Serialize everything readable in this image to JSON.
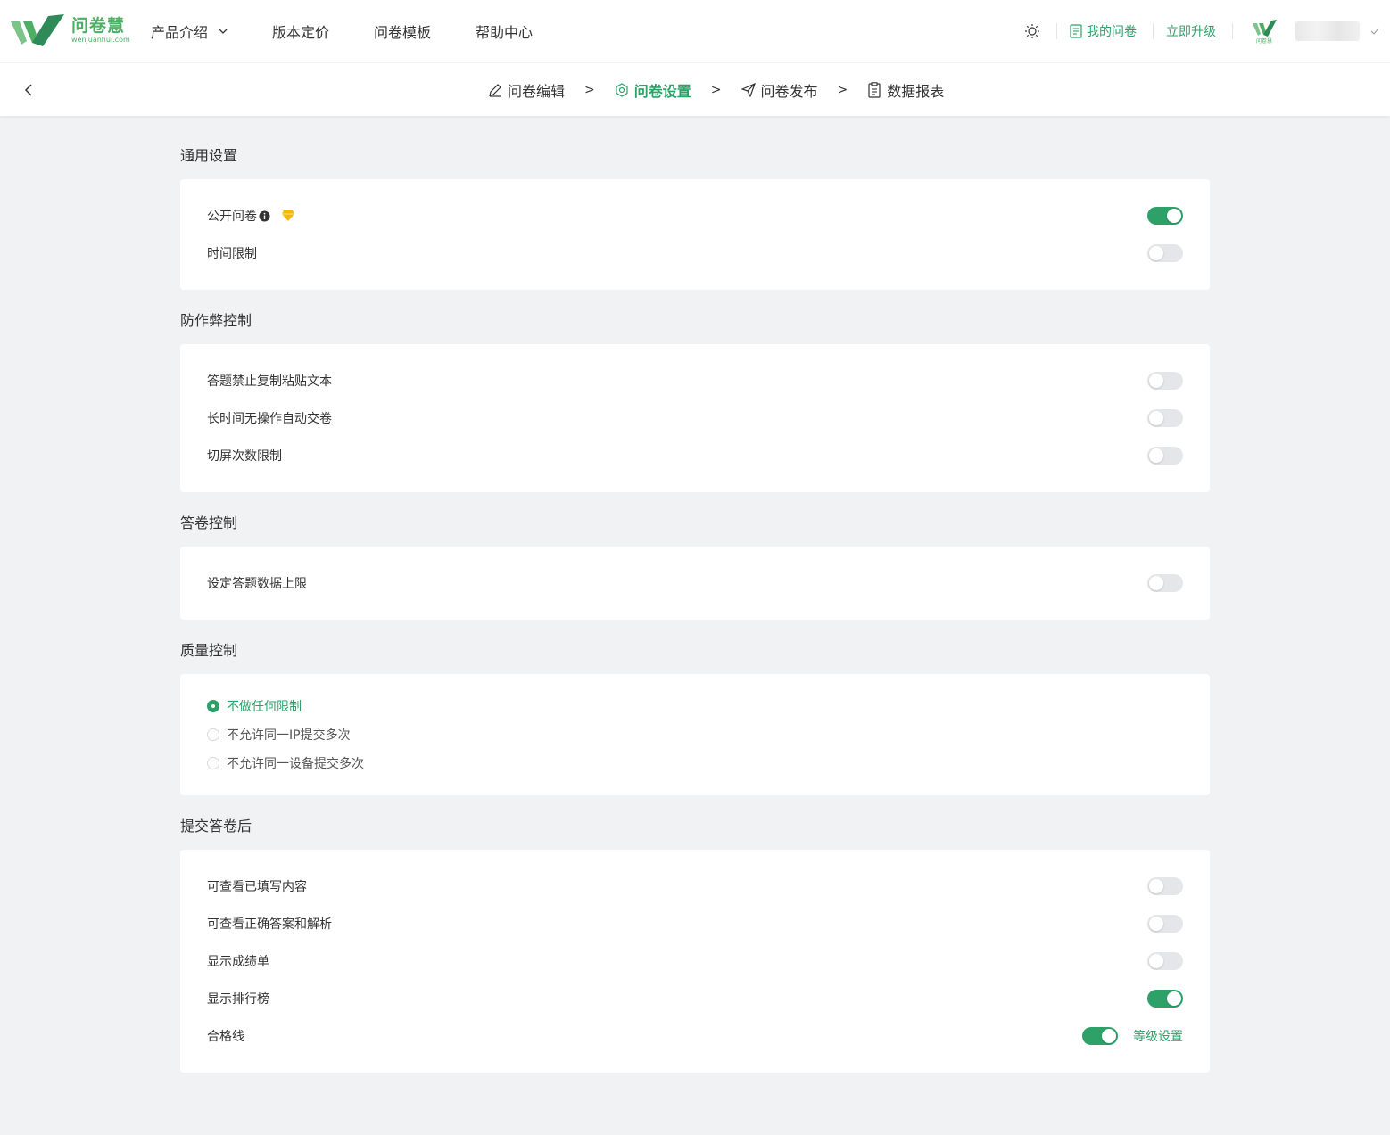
{
  "brand": {
    "name_cn": "问卷慧",
    "name_en": "wenjuanhui.com",
    "color": "#2ea169"
  },
  "nav": {
    "items": [
      {
        "label": "产品介绍",
        "has_dropdown": true
      },
      {
        "label": "版本定价"
      },
      {
        "label": "问卷模板"
      },
      {
        "label": "帮助中心"
      }
    ]
  },
  "toolbar": {
    "my_surveys": "我的问卷",
    "upgrade": "立即升级",
    "avatar_text": "问卷慧"
  },
  "steps": [
    {
      "label": "问卷编辑",
      "icon": "pencil-icon",
      "active": false
    },
    {
      "label": "问卷设置",
      "icon": "settings-icon",
      "active": true
    },
    {
      "label": "问卷发布",
      "icon": "send-icon",
      "active": false
    },
    {
      "label": "数据报表",
      "icon": "clipboard-icon",
      "active": false
    }
  ],
  "step_separator": ">",
  "sections": {
    "general": {
      "title": "通用设置",
      "items": [
        {
          "label": "公开问卷",
          "on": true,
          "has_info": true,
          "has_premium": true
        },
        {
          "label": "时间限制",
          "on": false
        }
      ]
    },
    "anti_cheat": {
      "title": "防作弊控制",
      "items": [
        {
          "label": "答题禁止复制粘贴文本",
          "on": false
        },
        {
          "label": "长时间无操作自动交卷",
          "on": false
        },
        {
          "label": "切屏次数限制",
          "on": false
        }
      ]
    },
    "answer_control": {
      "title": "答卷控制",
      "items": [
        {
          "label": "设定答题数据上限",
          "on": false
        }
      ]
    },
    "quality": {
      "title": "质量控制",
      "options": [
        {
          "label": "不做任何限制",
          "checked": true
        },
        {
          "label": "不允许同一IP提交多次",
          "checked": false
        },
        {
          "label": "不允许同一设备提交多次",
          "checked": false
        }
      ]
    },
    "after_submit": {
      "title": "提交答卷后",
      "items": [
        {
          "label": "可查看已填写内容",
          "on": false
        },
        {
          "label": "可查看正确答案和解析",
          "on": false
        },
        {
          "label": "显示成绩单",
          "on": false
        },
        {
          "label": "显示排行榜",
          "on": true
        },
        {
          "label": "合格线",
          "on": true,
          "extra_link": "等级设置"
        }
      ]
    }
  }
}
